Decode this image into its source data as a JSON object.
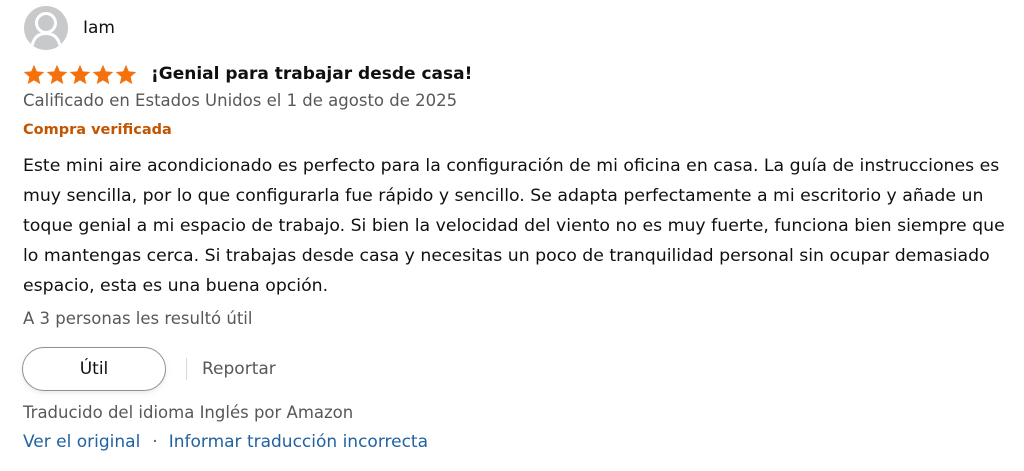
{
  "reviewer": {
    "name": "Iam",
    "avatar_icon": "default-profile-icon"
  },
  "rating": {
    "stars": 5,
    "max": 5,
    "color": "#f3720d"
  },
  "review": {
    "title": "¡Genial para trabajar desde casa!",
    "date": "Calificado en Estados Unidos el 1 de agosto de 2025",
    "verified_label": "Compra verificada",
    "body": "Este mini aire acondicionado es perfecto para la configuración de mi oficina en casa. La guía de instrucciones es muy sencilla, por lo que configurarla fue rápido y sencillo. Se adapta perfectamente a mi escritorio y añade un toque genial a mi espacio de trabajo. Si bien la velocidad del viento no es muy fuerte, funciona bien siempre que lo mantengas cerca. Si trabajas desde casa y necesitas un poco de tranquilidad personal sin ocupar demasiado espacio, esta es una buena opción."
  },
  "helpful": {
    "count_text": "A 3 personas les resultó útil",
    "button_label": "Útil",
    "report_label": "Reportar"
  },
  "translation": {
    "notice": "Traducido del idioma Inglés por Amazon",
    "view_original": "Ver el original",
    "separator": "·",
    "report_translation": "Informar traducción incorrecta"
  },
  "colors": {
    "verified": "#c45500",
    "link": "#2162a1",
    "secondary_text": "#565959"
  }
}
